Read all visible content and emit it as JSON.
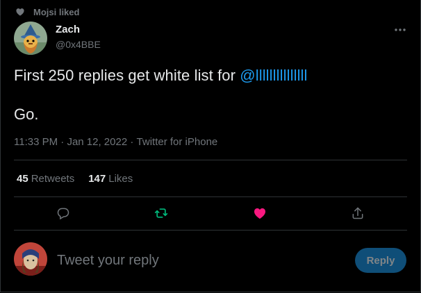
{
  "social_context": {
    "text": "Mojsi liked"
  },
  "author": {
    "name": "Zach",
    "handle": "@0x4BBE"
  },
  "tweet": {
    "line1_prefix": "First 250 replies get white list for ",
    "mention": "@lllllllllllllll",
    "line2": "Go."
  },
  "meta": {
    "time": "11:33 PM",
    "sep1": " · ",
    "date": "Jan 12, 2022",
    "sep2": " · ",
    "source": "Twitter for iPhone"
  },
  "stats": {
    "retweets_count": "45",
    "retweets_label": "Retweets",
    "likes_count": "147",
    "likes_label": "Likes"
  },
  "actions": {
    "reply_icon": "comment-icon",
    "retweet_icon": "retweet-icon",
    "like_icon": "heart-icon",
    "share_icon": "share-icon"
  },
  "composer": {
    "placeholder": "Tweet your reply",
    "button_label": "Reply"
  },
  "colors": {
    "accent": "#1d9bf0",
    "retweet": "#00ba7c",
    "like": "#f91880",
    "muted": "#71767b"
  }
}
